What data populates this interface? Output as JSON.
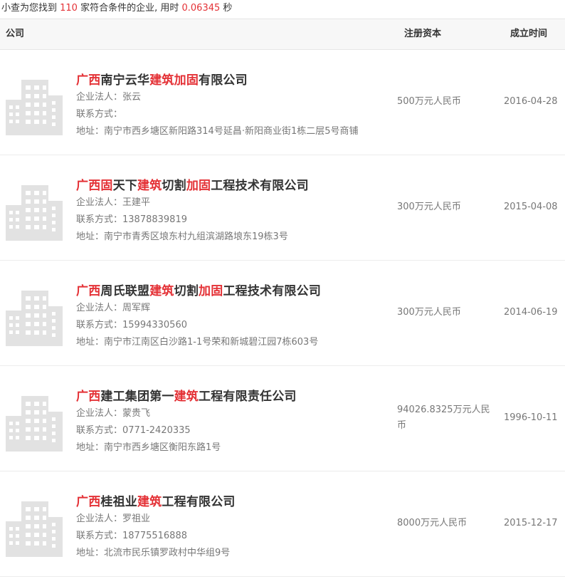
{
  "summary": {
    "prefix": "小查为您找到 ",
    "count": "110",
    "middle": " 家符合条件的企业, 用时 ",
    "time": "0.06345",
    "suffix": " 秒"
  },
  "header": {
    "company": "公司",
    "capital": "注册资本",
    "date": "成立时间"
  },
  "labels": {
    "legal": "企业法人：",
    "contact": "联系方式：",
    "address": "地址："
  },
  "icons": {
    "logo": "building-icon",
    "logo_color": "#e2e2e2"
  },
  "colors": {
    "highlight": "#e43136"
  },
  "companies": [
    {
      "name_parts": [
        {
          "text": "广西",
          "hl": true
        },
        {
          "text": "南宁云华",
          "hl": false
        },
        {
          "text": "建筑",
          "hl": true
        },
        {
          "text": "加固",
          "hl": true
        },
        {
          "text": "有限公司",
          "hl": false
        }
      ],
      "legal": "张云",
      "contact": "",
      "address": "南宁市西乡塘区新阳路314号延昌·新阳商业街1栋二层5号商铺",
      "capital": "500万元人民币",
      "date": "2016-04-28"
    },
    {
      "name_parts": [
        {
          "text": "广西",
          "hl": true
        },
        {
          "text": "固",
          "hl": true
        },
        {
          "text": "天下",
          "hl": false
        },
        {
          "text": "建筑",
          "hl": true
        },
        {
          "text": "切割",
          "hl": false
        },
        {
          "text": "加固",
          "hl": true
        },
        {
          "text": "工程技术有限公司",
          "hl": false
        }
      ],
      "legal": "王建平",
      "contact": "13878839819",
      "address": "南宁市青秀区埌东村九组滨湖路埌东19栋3号",
      "capital": "300万元人民币",
      "date": "2015-04-08"
    },
    {
      "name_parts": [
        {
          "text": "广西",
          "hl": true
        },
        {
          "text": "周氏联盟",
          "hl": false
        },
        {
          "text": "建筑",
          "hl": true
        },
        {
          "text": "切割",
          "hl": false
        },
        {
          "text": "加固",
          "hl": true
        },
        {
          "text": "工程技术有限公司",
          "hl": false
        }
      ],
      "legal": "周军辉",
      "contact": "15994330560",
      "address": "南宁市江南区白沙路1-1号荣和新城碧江园7栋603号",
      "capital": "300万元人民币",
      "date": "2014-06-19"
    },
    {
      "name_parts": [
        {
          "text": "广西",
          "hl": true
        },
        {
          "text": "建工集团第一",
          "hl": false
        },
        {
          "text": "建筑",
          "hl": true
        },
        {
          "text": "工程有限责任公司",
          "hl": false
        }
      ],
      "legal": "蒙贵飞",
      "contact": "0771-2420335",
      "address": "南宁市西乡塘区衡阳东路1号",
      "capital": "94026.8325万元人民币",
      "date": "1996-10-11"
    },
    {
      "name_parts": [
        {
          "text": "广西",
          "hl": true
        },
        {
          "text": "桂祖业",
          "hl": false
        },
        {
          "text": "建筑",
          "hl": true
        },
        {
          "text": "工程有限公司",
          "hl": false
        }
      ],
      "legal": "罗祖业",
      "contact": "18775516888",
      "address": "北流市民乐镇罗政村中华组9号",
      "capital": "8000万元人民币",
      "date": "2015-12-17"
    }
  ]
}
